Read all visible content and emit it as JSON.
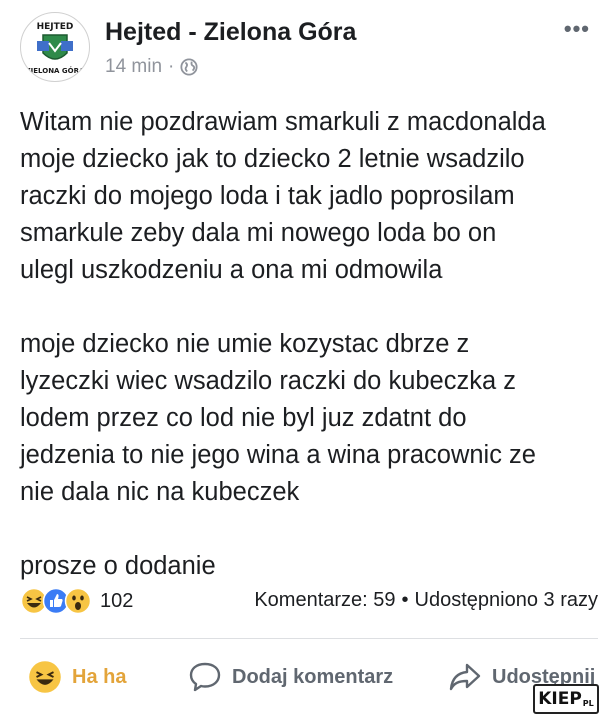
{
  "post": {
    "page_name": "Hejted - Zielona Góra",
    "time": "14 min",
    "avatar_text_top": "HEJTED",
    "avatar_text_bottom": "ZIELONA GÓRA",
    "more_label": "•••",
    "text": "Witam nie pozdrawiam smarkuli z macdonalda\nmoje dziecko jak to dziecko 2 letnie wsadzilo\nraczki do mojego loda i tak jadlo poprosilam\nsmarkule zeby dala mi nowego loda bo on\nulegl uszkodzeniu a ona mi odmowila\n\nmoje dziecko nie umie kozystac dbrze z\nlyzeczki wiec wsadzilo raczki do kubeczka z\nlodem przez co lod nie byl juz zdatnt do\njedzenia to nie jego wina a wina pracownic ze\nnie dala nic na kubeczek\n\nprosze o dodanie"
  },
  "stats": {
    "reaction_count": "102",
    "comments": "Komentarze: 59",
    "shares": "Udostępniono 3 razy"
  },
  "actions": {
    "haha": "Ha ha",
    "comment": "Dodaj komentarz",
    "share": "Udostępnij"
  },
  "watermark": {
    "text": "KIEP",
    "suffix": "PL"
  },
  "colors": {
    "haha": "#e3a43a",
    "like": "#3b7cf5",
    "meta": "#90949c"
  }
}
